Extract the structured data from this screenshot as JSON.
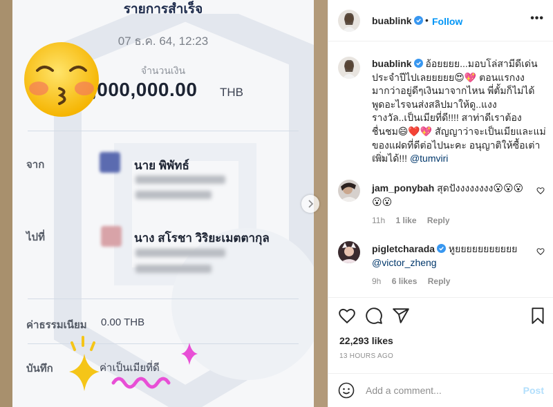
{
  "media": {
    "slip": {
      "title": "รายการสำเร็จ",
      "date": "07 ธ.ค. 64, 12:23",
      "amount_label": "จำนวนเงิน",
      "amount": ",000,000.00",
      "currency": "THB",
      "from_label": "จาก",
      "from_name": "นาย พิพัทธ์",
      "to_label": "ไปที่",
      "to_name": "นาง สโรชา วิริยะเมตตากุล",
      "fee_label": "ค่าธรรมเนียม",
      "fee_value": "0.00 THB",
      "note_label": "บันทึก",
      "note_value": "ค่าเป็นเมียที่ดี"
    },
    "icons": [
      "kissing-face-emoji-icon",
      "chevron-right-icon",
      "sparkle-doodle-icon"
    ]
  },
  "post": {
    "header": {
      "username": "buablink",
      "dot": "•",
      "follow_label": "Follow",
      "more_label": "•••"
    },
    "caption": {
      "username": "buablink",
      "text": "อ้อยยยย...มอบโล่สามีดีเด่นประจำปีไปเลยยยยย😍💖 ตอนแรกงงมากว่าอยู่ดีๆเงินมาจากไหน พี่ตั้มก็ไม่ได้พูดอะไรจนส่งสลิปมาให้ดู..แงง รางวัล..เป็นเมียที่ดี!!!! สาท่าดีเราต้องชื่นชม😄❤️💖 สัญญาว่าจะเป็นเมียและแม่ของแฝดที่ดีต่อไปนะคะ อนุญาติให้ซื้อเต่าเพิ่มได้!!! ",
      "mention": "@tumviri",
      "age": "13h"
    },
    "comments": [
      {
        "username": "jam_ponybah",
        "text": "สุดปังงงงงงงง😮😮😮😮😮",
        "age": "11h",
        "likes": "1 like",
        "reply": "Reply"
      },
      {
        "username": "pigletcharada",
        "text": "หูยยยยยยยยยยย ",
        "mention": "@victor_zheng",
        "age": "9h",
        "likes": "6 likes",
        "reply": "Reply"
      }
    ],
    "likes_count": "22,293 likes",
    "timestamp": "13 HOURS AGO",
    "add_comment_placeholder": "Add a comment...",
    "post_label": "Post",
    "colors": {
      "link": "#0095f6",
      "mention": "#00376b",
      "muted": "#8e8e8e",
      "verified": "#3897f0"
    }
  }
}
